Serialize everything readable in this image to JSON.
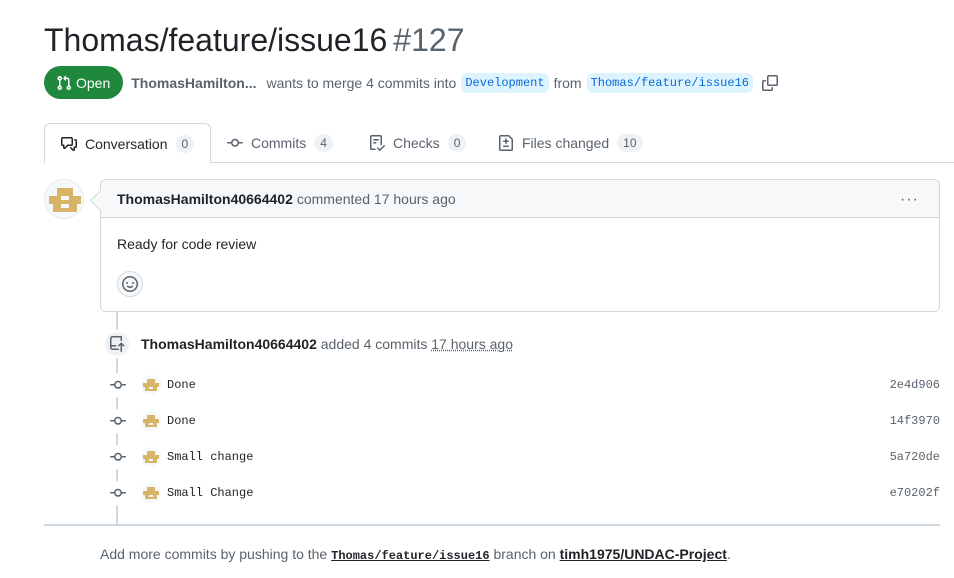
{
  "pr": {
    "title": "Thomas/feature/issue16",
    "number": "#127",
    "state": "Open",
    "author": "ThomasHamilton...",
    "merge_text": "wants to merge 4 commits into",
    "base_branch": "Development",
    "from_text": "from",
    "head_branch": "Thomas/feature/issue16"
  },
  "tabs": [
    {
      "label": "Conversation",
      "count": "0",
      "icon": "comment-discussion-icon"
    },
    {
      "label": "Commits",
      "count": "4",
      "icon": "git-commit-icon"
    },
    {
      "label": "Checks",
      "count": "0",
      "icon": "checklist-icon"
    },
    {
      "label": "Files changed",
      "count": "10",
      "icon": "file-diff-icon"
    }
  ],
  "comment": {
    "author": "ThomasHamilton40664402",
    "action": "commented",
    "time": "17 hours ago",
    "body": "Ready for code review",
    "menu": "···"
  },
  "event": {
    "author": "ThomasHamilton40664402",
    "action": "added 4 commits",
    "time": "17 hours ago"
  },
  "commits": [
    {
      "message": "Done",
      "sha": "2e4d906"
    },
    {
      "message": "Done",
      "sha": "14f3970"
    },
    {
      "message": "Small change",
      "sha": "5a720de"
    },
    {
      "message": "Small Change",
      "sha": "e70202f"
    }
  ],
  "footer": {
    "prefix": "Add more commits by pushing to the",
    "branch": "Thomas/feature/issue16",
    "middle": "branch on",
    "repo": "timh1975/UNDAC-Project",
    "suffix": "."
  },
  "colors": {
    "open_green": "#1f883d",
    "branch_blue": "#0969da",
    "avatar_tan": "#d8b36a"
  }
}
